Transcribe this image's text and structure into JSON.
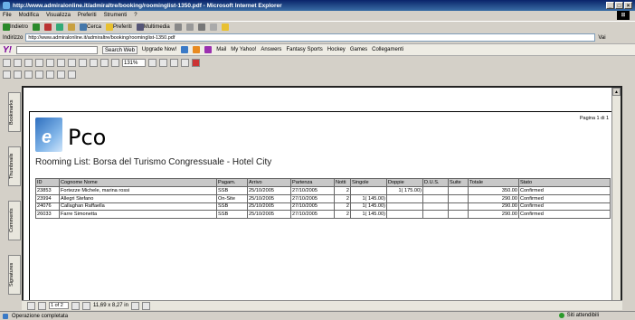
{
  "window": {
    "title": "http://www.admiralonline.it/admiraltre/booking/roominglist-1350.pdf - Microsoft Internet Explorer",
    "min": "_",
    "max": "□",
    "close": "×"
  },
  "menu": [
    "File",
    "Modifica",
    "Visualizza",
    "Preferiti",
    "Strumenti",
    "?"
  ],
  "nav": {
    "back": "Indietro",
    "search": "Cerca",
    "favorites": "Preferiti",
    "multimedia": "Multimedia"
  },
  "address": {
    "label": "Indirizzo",
    "url": "http://www.admiralonline.it/admiraltre/booking/roominglist-1350.pdf",
    "go": "Vai",
    "links": "Collegamenti"
  },
  "yahoo": {
    "search_web": "Search Web",
    "upgrade": "Upgrade Now!",
    "mail": "Mail",
    "my_yahoo": "My Yahoo!",
    "answers": "Answers",
    "fantasy": "Fantasy Sports",
    "hockey": "Hockey",
    "games": "Games"
  },
  "pdf": {
    "zoom": "131%",
    "page_field": "1 of 2",
    "page_size": "11,69 x 8,27 in"
  },
  "sidetabs": [
    "Bookmarks",
    "Thumbnails",
    "Comments",
    "Signatures"
  ],
  "doc": {
    "logo_text": "Pco",
    "page_of": "Pagina 1 di 1",
    "title": "Rooming List: Borsa del Turismo Congressuale - Hotel City",
    "columns": [
      "ID",
      "Cognome Nome",
      "Pagam.",
      "Arrivo",
      "Partenza",
      "Notti",
      "Singole",
      "Doppie",
      "D.U.S.",
      "Suite",
      "Totale",
      "Stato"
    ],
    "rows": [
      [
        "23853",
        "Fortezze Michele, marina rossi",
        "SSB",
        "25/10/2005",
        "27/10/2005",
        "2",
        "",
        "1( 175.00)",
        "",
        "",
        "350.00",
        "Confirmed"
      ],
      [
        "23994",
        "Allegri Stefano",
        "On-Site",
        "25/10/2005",
        "27/10/2005",
        "2",
        "1( 145.00)",
        "",
        "",
        "",
        "290.00",
        "Confirmed"
      ],
      [
        "24076",
        "Callaghan Raffaella",
        "SSB",
        "25/10/2005",
        "27/10/2005",
        "2",
        "1( 145.00)",
        "",
        "",
        "",
        "290.00",
        "Confirmed"
      ],
      [
        "26033",
        "Farre Simonetta",
        "SSB",
        "25/10/2005",
        "27/10/2005",
        "2",
        "1( 145.00)",
        "",
        "",
        "",
        "290.00",
        "Confirmed"
      ]
    ]
  },
  "status": {
    "left": "Operazione completata",
    "right": "Siti attendibili"
  }
}
